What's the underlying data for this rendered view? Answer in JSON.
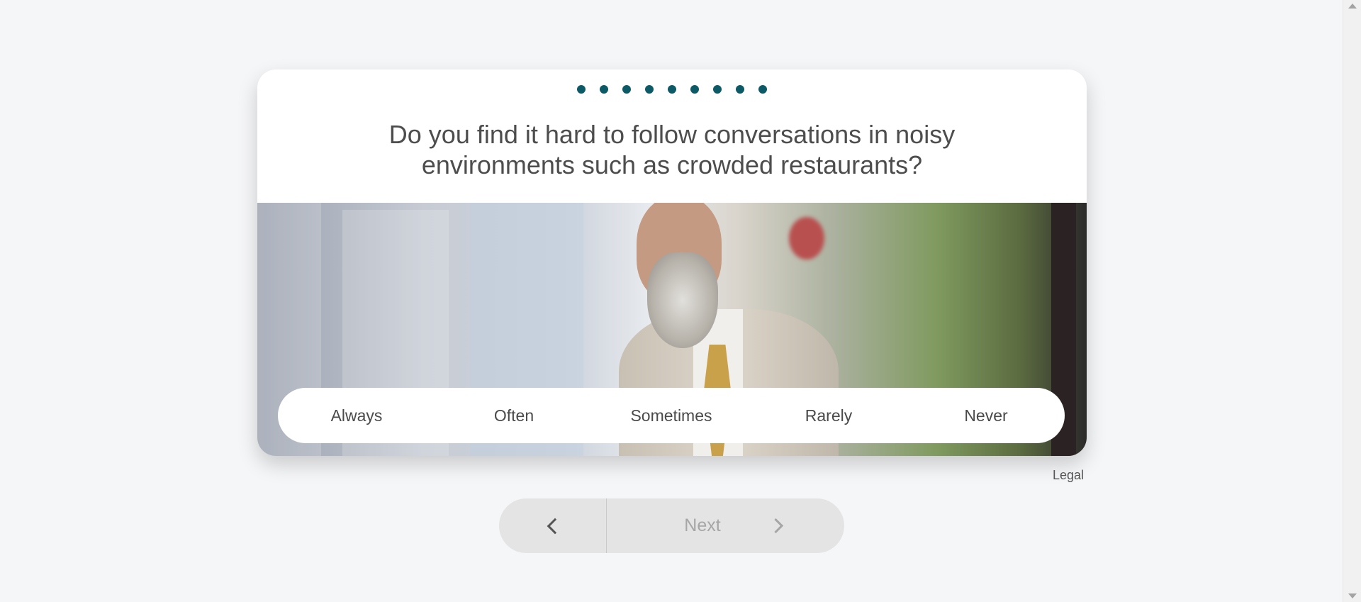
{
  "progress": {
    "dot_count": 9,
    "dot_color": "#0b5a66"
  },
  "question": {
    "line1": "Do you find it hard to follow conversations in noisy",
    "line2": "environments such as crowded restaurants?"
  },
  "answers": [
    "Always",
    "Often",
    "Sometimes",
    "Rarely",
    "Never"
  ],
  "footer": {
    "legal_label": "Legal"
  },
  "navigation": {
    "back_icon": "chevron-left-icon",
    "next_label": "Next",
    "next_icon": "chevron-right-icon",
    "next_enabled": false
  },
  "colors": {
    "accent": "#0b5a66",
    "page_background": "#f5f6f8",
    "nav_background": "#e4e4e4"
  }
}
